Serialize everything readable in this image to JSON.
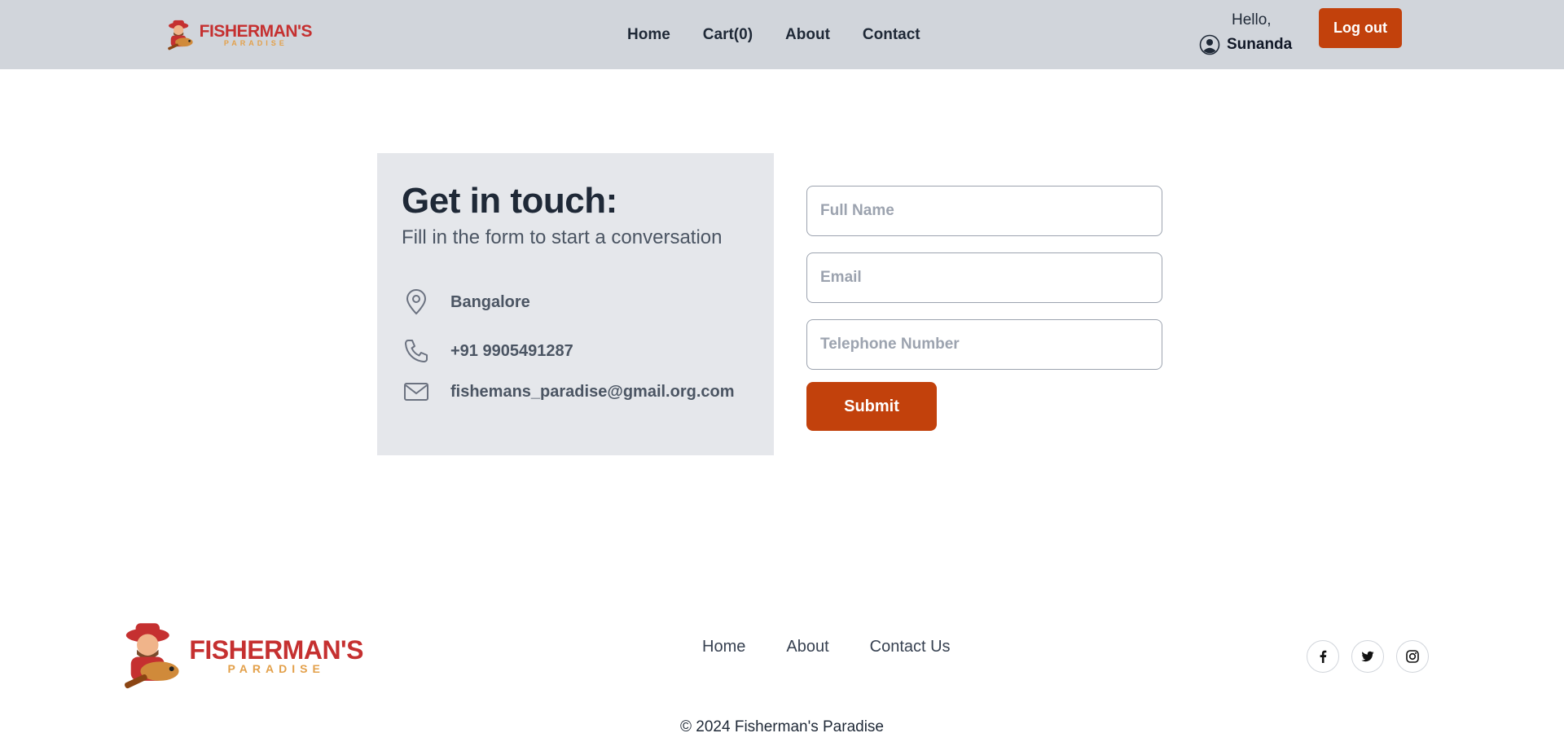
{
  "brand": {
    "name": "FISHERMAN'S",
    "tagline": "PARADISE",
    "primary_color": "#c2410c",
    "logo_red": "#c53030",
    "logo_gold": "#e3a04a"
  },
  "header": {
    "nav": [
      {
        "label": "Home"
      },
      {
        "label": "Cart(0)"
      },
      {
        "label": "About"
      },
      {
        "label": "Contact"
      }
    ],
    "greeting": "Hello,",
    "username": "Sunanda",
    "logout_label": "Log out"
  },
  "contact": {
    "title": "Get in touch:",
    "subtitle": "Fill in the form to start a conversation",
    "location": "Bangalore",
    "phone": "+91 9905491287",
    "email": "fishemans_paradise@gmail.org.com"
  },
  "form": {
    "full_name_placeholder": "Full Name",
    "email_placeholder": "Email",
    "phone_placeholder": "Telephone Number",
    "submit_label": "Submit"
  },
  "footer": {
    "nav": [
      {
        "label": "Home"
      },
      {
        "label": "About"
      },
      {
        "label": "Contact Us"
      }
    ],
    "socials": [
      "facebook-icon",
      "twitter-icon",
      "instagram-icon"
    ],
    "copyright": "© 2024 Fisherman's Paradise"
  }
}
